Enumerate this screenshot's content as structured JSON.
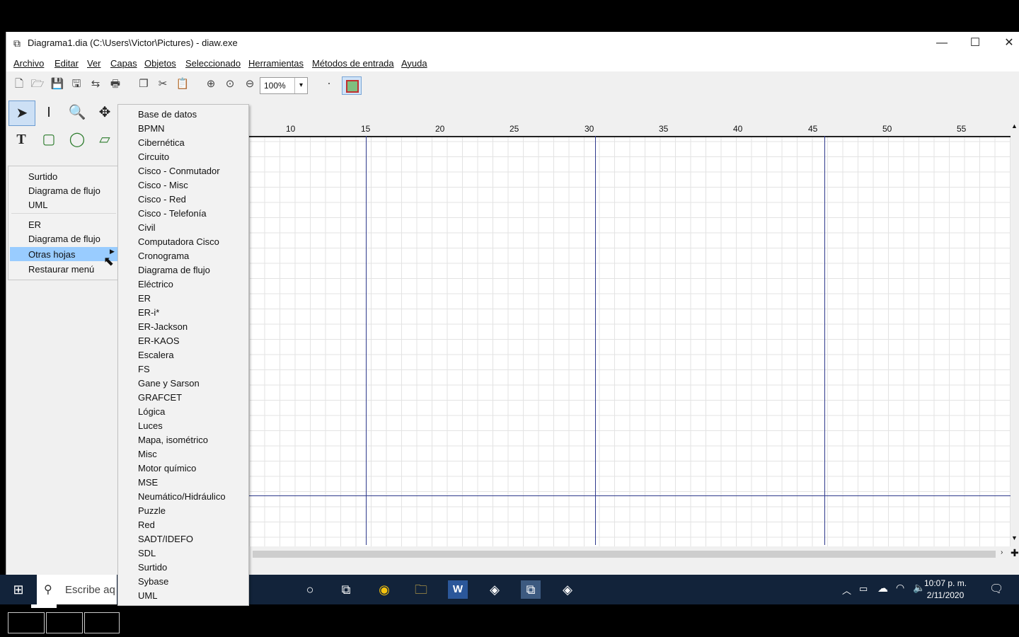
{
  "window": {
    "title": "Diagrama1.dia (C:\\Users\\Victor\\Pictures) - diaw.exe",
    "minimize": "—",
    "maximize": "☐",
    "close": "✕"
  },
  "menubar": [
    "Archivo",
    "Editar",
    "Ver",
    "Capas",
    "Objetos",
    "Seleccionado",
    "Herramientas",
    "Métodos de entrada",
    "Ayuda"
  ],
  "toolbar": {
    "zoom_value": "100%"
  },
  "sheet_menu": {
    "items": [
      "Surtido",
      "Diagrama de flujo",
      "UML",
      "ER",
      "Diagrama de flujo",
      "Otras hojas",
      "Restaurar menú"
    ],
    "highlighted": "Otras hojas"
  },
  "submenu": {
    "items": [
      "Base de datos",
      "BPMN",
      "Cibernética",
      "Circuito",
      "Cisco - Conmutador",
      "Cisco - Misc",
      "Cisco - Red",
      "Cisco - Telefonía",
      "Civil",
      "Computadora Cisco",
      "Cronograma",
      "Diagrama de flujo",
      "Eléctrico",
      "ER",
      "ER-i*",
      "ER-Jackson",
      "ER-KAOS",
      "Escalera",
      "FS",
      "Gane y Sarson",
      "GRAFCET",
      "Lógica",
      "Luces",
      "Mapa, isométrico",
      "Misc",
      "Motor químico",
      "MSE",
      "Neumático/Hidráulico",
      "Puzzle",
      "Red",
      "SADT/IDEFO",
      "SDL",
      "Surtido",
      "Sybase",
      "UML"
    ]
  },
  "ruler": {
    "labels": [
      "10",
      "15",
      "20",
      "25",
      "30",
      "35",
      "40",
      "45",
      "50",
      "55"
    ]
  },
  "taskbar": {
    "search_placeholder": "Escribe aq",
    "time": "10:07 p. m.",
    "date": "2/11/2020"
  },
  "colors": {
    "highlight": "#99ccff",
    "guide_line": "#2f3a8c",
    "taskbar": "#12233a"
  }
}
